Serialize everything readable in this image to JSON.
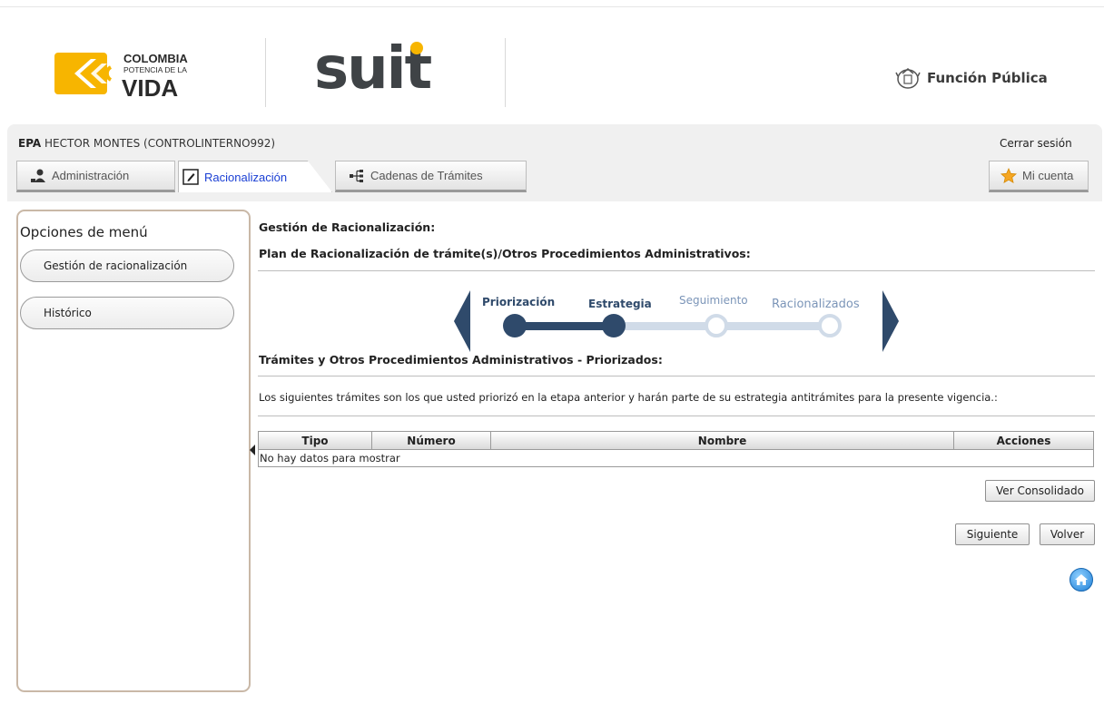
{
  "header": {
    "logo_colombia": [
      "COLOMBIA",
      "POTENCIA DE LA",
      "VIDA"
    ],
    "logo_suit": "suit",
    "funcion_publica": "Función Pública"
  },
  "user": {
    "entity": "EPA",
    "name": "HECTOR MONTES (CONTROLINTERNO992)",
    "logout": "Cerrar sesión"
  },
  "tabs": {
    "admin": "Administración",
    "racionalizacion": "Racionalización",
    "cadenas": "Cadenas de Trámites",
    "mi_cuenta": "Mi cuenta"
  },
  "sidebar": {
    "title": "Opciones de menú",
    "items": [
      "Gestión de racionalización",
      "Histórico"
    ]
  },
  "main": {
    "title": "Gestión de Racionalización:",
    "subtitle": "Plan de Racionalización de trámite(s)/Otros Procedimientos Administrativos:",
    "steps": [
      {
        "label": "Priorización",
        "state": "done"
      },
      {
        "label": "Estrategia",
        "state": "done"
      },
      {
        "label": "Seguimiento",
        "state": "todo"
      },
      {
        "label": "Racionalizados",
        "state": "todo"
      }
    ],
    "section_title": "Trámites y Otros Procedimientos Administrativos - Priorizados:",
    "description": "Los siguientes trámites son los que usted priorizó en la etapa anterior y harán parte de su estrategia antitrámites para la presente vigencia.:",
    "table": {
      "columns": [
        "Tipo",
        "Número",
        "Nombre",
        "Acciones"
      ],
      "empty_message": "No hay datos para mostrar"
    },
    "buttons": {
      "consolidado": "Ver Consolidado",
      "siguiente": "Siguiente",
      "volver": "Volver"
    }
  },
  "colors": {
    "accent_blue": "#2f4a6b",
    "tab_active_text": "#1a3fd4",
    "colombia_yellow": "#f7b500"
  }
}
